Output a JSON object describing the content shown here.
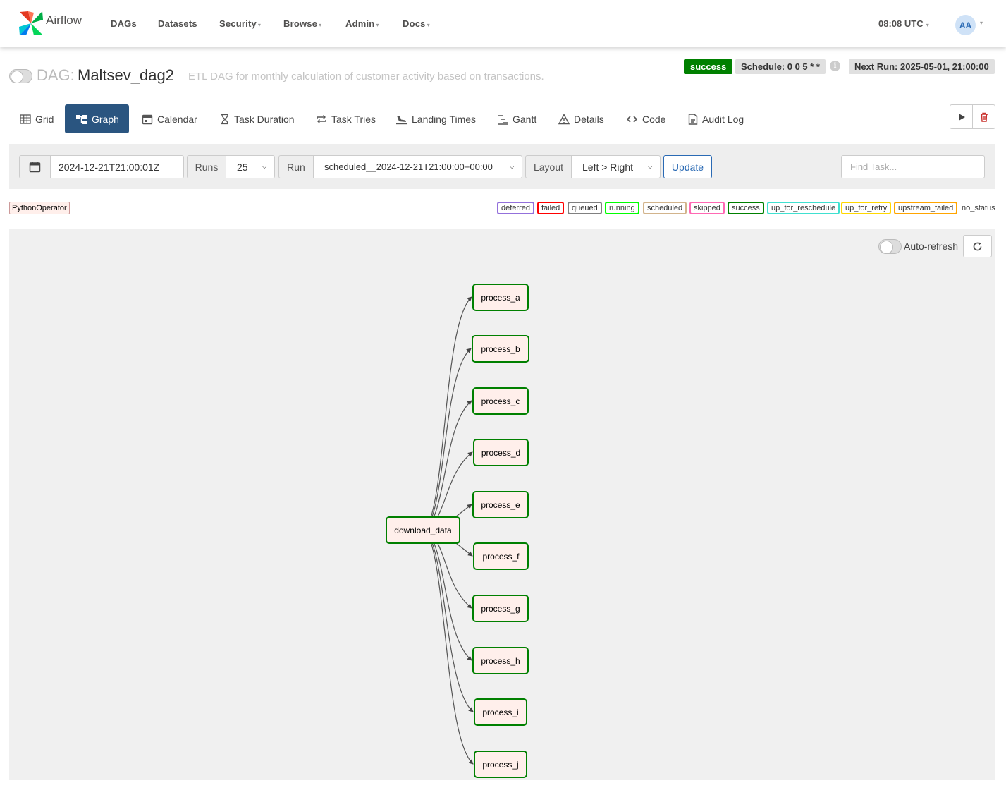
{
  "navbar": {
    "brand": "Airflow",
    "items": [
      {
        "label": "DAGs",
        "dropdown": false
      },
      {
        "label": "Datasets",
        "dropdown": false
      },
      {
        "label": "Security",
        "dropdown": true
      },
      {
        "label": "Browse",
        "dropdown": true
      },
      {
        "label": "Admin",
        "dropdown": true
      },
      {
        "label": "Docs",
        "dropdown": true
      }
    ],
    "clock": "08:08 UTC",
    "user_initials": "AA"
  },
  "dag": {
    "prefix": "DAG:",
    "name": "Maltsev_dag2",
    "description": "ETL DAG for monthly calculation of customer activity based on transactions.",
    "state": "success",
    "schedule": "Schedule: 0 0 5 * *",
    "next_run": "Next Run: 2025-05-01, 21:00:00"
  },
  "tabs": [
    {
      "label": "Grid",
      "icon": "grid-icon",
      "active": false
    },
    {
      "label": "Graph",
      "icon": "graph-icon",
      "active": true
    },
    {
      "label": "Calendar",
      "icon": "calendar-icon",
      "active": false
    },
    {
      "label": "Task Duration",
      "icon": "hourglass-icon",
      "active": false
    },
    {
      "label": "Task Tries",
      "icon": "retry-icon",
      "active": false
    },
    {
      "label": "Landing Times",
      "icon": "landing-icon",
      "active": false
    },
    {
      "label": "Gantt",
      "icon": "gantt-icon",
      "active": false
    },
    {
      "label": "Details",
      "icon": "warning-triangle-icon",
      "active": false
    },
    {
      "label": "Code",
      "icon": "code-icon",
      "active": false
    },
    {
      "label": "Audit Log",
      "icon": "document-icon",
      "active": false
    }
  ],
  "filters": {
    "base_date": "2024-12-21T21:00:01Z",
    "runs_label": "Runs",
    "runs_value": "25",
    "run_label": "Run",
    "run_value": "scheduled__2024-12-21T21:00:00+00:00",
    "layout_label": "Layout",
    "layout_value": "Left > Right",
    "update_label": "Update",
    "find_placeholder": "Find Task..."
  },
  "legend": {
    "operators": [
      "PythonOperator"
    ],
    "states": [
      {
        "label": "deferred",
        "color": "#9370db"
      },
      {
        "label": "failed",
        "color": "#ff0000"
      },
      {
        "label": "queued",
        "color": "#808080"
      },
      {
        "label": "running",
        "color": "#00ff00"
      },
      {
        "label": "scheduled",
        "color": "#d2b48c"
      },
      {
        "label": "skipped",
        "color": "#ff69b4"
      },
      {
        "label": "success",
        "color": "#008000"
      },
      {
        "label": "up_for_reschedule",
        "color": "#40e0d0"
      },
      {
        "label": "up_for_retry",
        "color": "#ffd700"
      },
      {
        "label": "upstream_failed",
        "color": "#ffa500"
      },
      {
        "label": "no_status",
        "color": null
      }
    ]
  },
  "graph": {
    "auto_refresh_label": "Auto-refresh",
    "root": "download_data",
    "tasks": [
      "process_a",
      "process_b",
      "process_c",
      "process_d",
      "process_e",
      "process_f",
      "process_g",
      "process_h",
      "process_i",
      "process_j"
    ],
    "task_state": "success",
    "operator_color": "#ffefeb"
  }
}
